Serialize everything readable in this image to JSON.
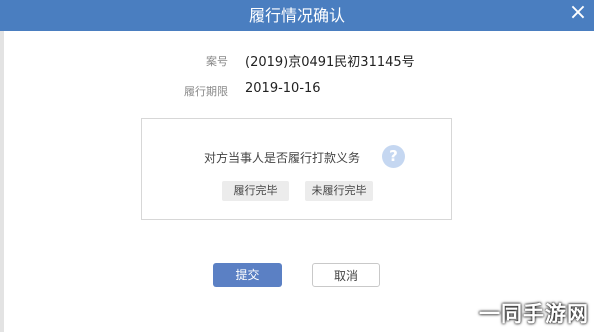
{
  "dialog": {
    "title": "履行情况确认",
    "close_glyph": "×"
  },
  "fields": [
    {
      "label": "案号",
      "value": "(2019)京0491民初31145号"
    },
    {
      "label": "履行期限",
      "value": "2019-10-16"
    }
  ],
  "question": {
    "text": "对方当事人是否履行打款义务",
    "help_glyph": "?",
    "options": [
      "履行完毕",
      "未履行完毕"
    ]
  },
  "buttons": {
    "submit": "提交",
    "cancel": "取消"
  },
  "watermark": "一同手游网",
  "colors": {
    "header": "#4a7ec0",
    "submit": "#5b80c4",
    "help_icon": "#c5d7f1"
  }
}
